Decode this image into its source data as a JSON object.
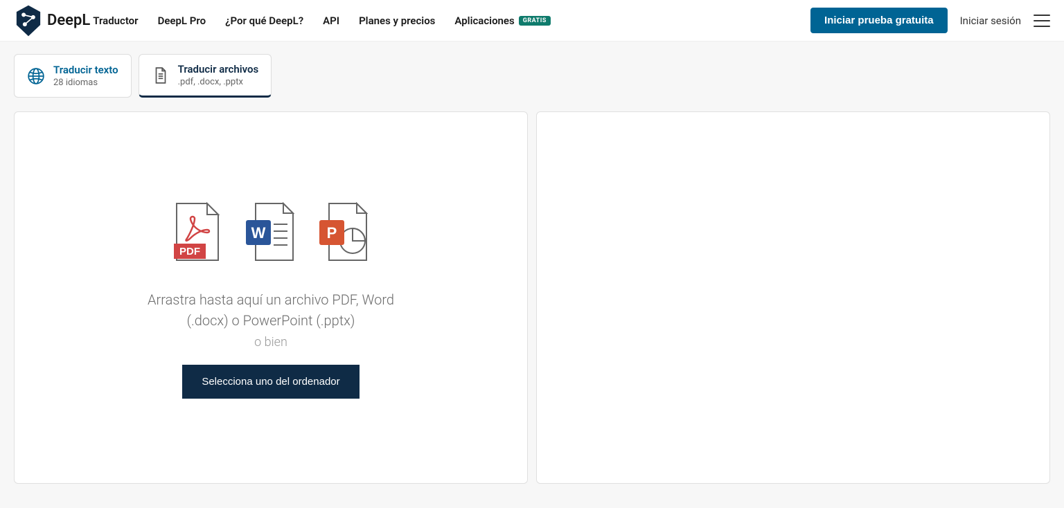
{
  "brand": "DeepL",
  "nav": {
    "translator": "Traductor",
    "pro": "DeepL Pro",
    "why": "¿Por qué DeepL?",
    "api": "API",
    "plans": "Planes y precios",
    "apps": "Aplicaciones",
    "apps_badge": "GRATIS"
  },
  "header": {
    "start_trial": "Iniciar prueba gratuita",
    "login": "Iniciar sesión"
  },
  "tabs": {
    "text": {
      "title": "Traducir texto",
      "sub": "28 idiomas"
    },
    "files": {
      "title": "Traducir archivos",
      "sub": ".pdf, .docx, .pptx"
    }
  },
  "drop": {
    "text": "Arrastra hasta aquí un archivo PDF, Word (.docx) o PowerPoint (.pptx)",
    "or": "o bien",
    "select": "Selecciona uno del ordenador"
  }
}
